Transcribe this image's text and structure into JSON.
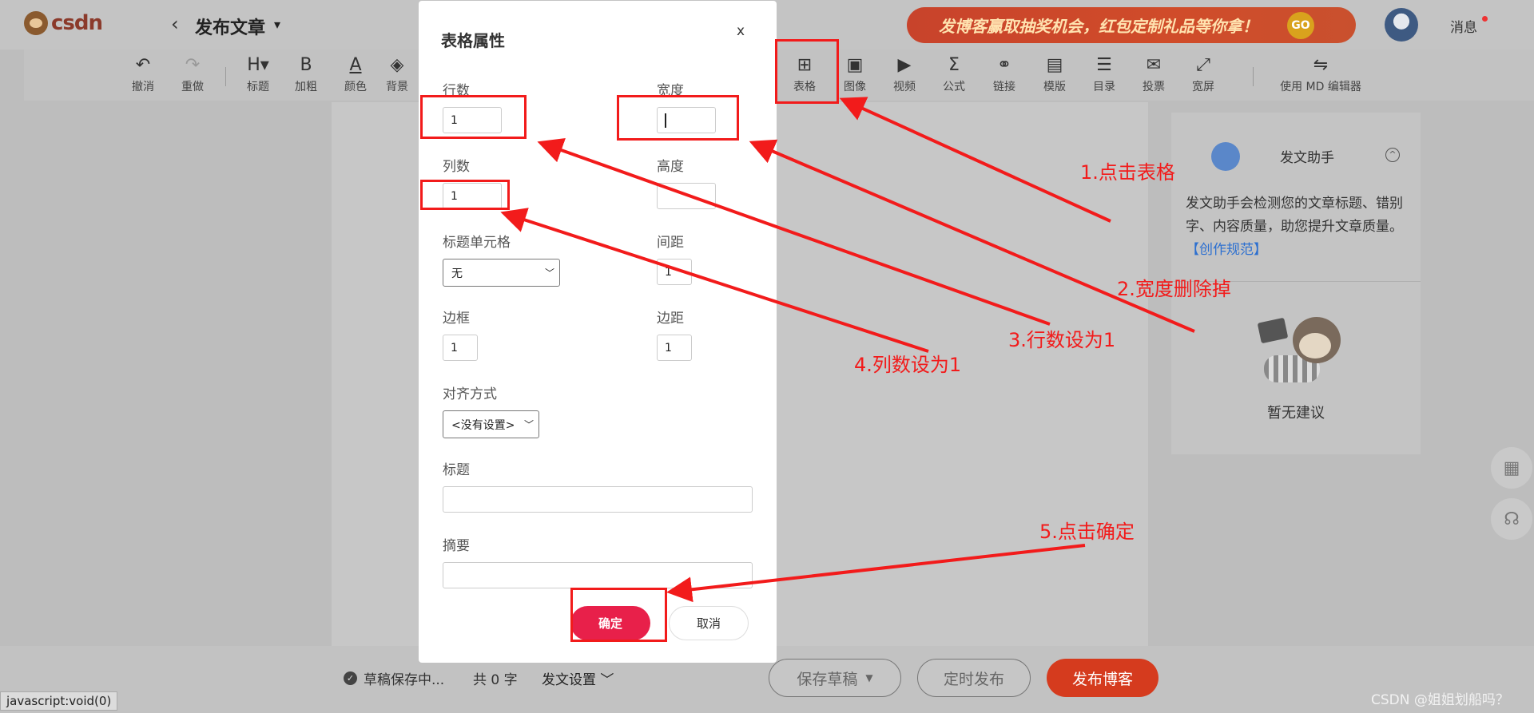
{
  "header": {
    "logo_text": "csdn",
    "back_glyph": "‹",
    "title": "发布文章",
    "title_caret": "▾",
    "banner_text": "发博客赢取抽奖机会，红包定制礼品等你拿！",
    "banner_go": "GO",
    "messages_label": "消息"
  },
  "toolbar": {
    "items": [
      {
        "icon": "↶",
        "label": "撤消"
      },
      {
        "icon": "↷",
        "label": "重做"
      },
      {
        "icon": "H▾",
        "label": "标题"
      },
      {
        "icon": "B",
        "label": "加粗"
      },
      {
        "icon": "A",
        "label": "颜色"
      },
      {
        "icon": "◈",
        "label": "背景"
      },
      {
        "icon": "⊞",
        "label": "表格"
      },
      {
        "icon": "▣",
        "label": "图像"
      },
      {
        "icon": "▶",
        "label": "视频"
      },
      {
        "icon": "Σ",
        "label": "公式"
      },
      {
        "icon": "⚭",
        "label": "链接"
      },
      {
        "icon": "▤",
        "label": "模版"
      },
      {
        "icon": "☰",
        "label": "目录"
      },
      {
        "icon": "✉",
        "label": "投票"
      },
      {
        "icon": "⤢",
        "label": "宽屏"
      },
      {
        "icon": "⇋",
        "label": "使用 MD 编辑器"
      }
    ]
  },
  "dialog": {
    "title": "表格属性",
    "close": "x",
    "rows_label": "行数",
    "rows_value": "1",
    "width_label": "宽度",
    "width_value": "",
    "cols_label": "列数",
    "cols_value": "1",
    "height_label": "高度",
    "height_value": "",
    "header_cells_label": "标题单元格",
    "header_cells_value": "无",
    "spacing_label": "间距",
    "spacing_value": "1",
    "border_label": "边框",
    "border_value": "1",
    "padding_label": "边距",
    "padding_value": "1",
    "align_label": "对齐方式",
    "align_value": "<没有设置>",
    "caption_label": "标题",
    "caption_value": "",
    "summary_label": "摘要",
    "summary_value": "",
    "ok_label": "确定",
    "cancel_label": "取消"
  },
  "assistant": {
    "title": "发文助手",
    "toggle": "^",
    "description": "发文助手会检测您的文章标题、错别字、内容质量，助您提升文章质量。",
    "link": "【创作规范】",
    "no_suggestion": "暂无建议"
  },
  "bottom": {
    "draft_status": "草稿保存中...",
    "word_count": "共 0 字",
    "publish_settings": "发文设置",
    "save_draft": "保存草稿",
    "timed_publish": "定时发布",
    "publish": "发布博客",
    "status_url": "javascript:void(0)",
    "watermark": "CSDN @姐姐划船吗？"
  },
  "annotations": [
    "1.点击表格",
    "2.宽度删除掉",
    "3.行数设为1",
    "4.列数设为1",
    "5.点击确定"
  ],
  "colors": {
    "annotation_red": "#f21b1b",
    "confirm_button": "#e8204a",
    "publish_button": "#d53b1e"
  }
}
